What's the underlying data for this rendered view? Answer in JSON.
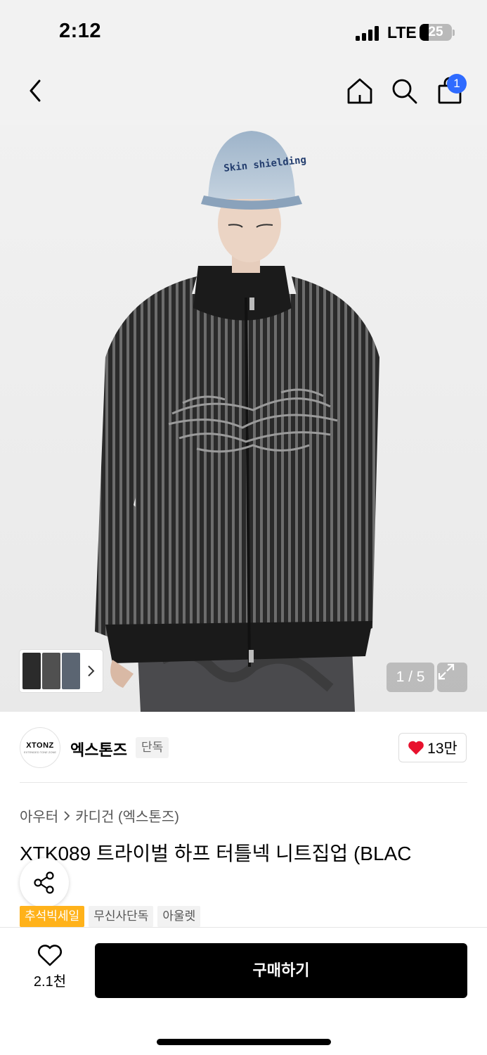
{
  "status_bar": {
    "time": "2:12",
    "network": "LTE",
    "battery": "25"
  },
  "nav": {
    "back_icon": "chevron-left-icon",
    "home_icon": "home-icon",
    "search_icon": "search-icon",
    "cart_icon": "shopping-bag-icon",
    "cart_count": "1",
    "badge_color": "#2f6bff"
  },
  "gallery": {
    "page": "1 / 5",
    "expand_icon": "expand-icon",
    "thumb_next_icon": "chevron-right-icon"
  },
  "brand": {
    "logo_text": "XTONZ",
    "logo_subtext": "EXTENDED TONE ZONE",
    "name": "엑스톤즈",
    "tag": "단독",
    "likes": "13만",
    "heart_color": "#e8112d"
  },
  "breadcrumb": {
    "level1": "아우터",
    "level2": "카디건 (엑스톤즈)"
  },
  "product": {
    "title": "XTK089 트라이벌 하프 터틀넥 니트집업 (BLAC",
    "tags": [
      "추석빅세일",
      "무신사단독",
      "아울렛"
    ],
    "sale_tag_color": "#ffb21a"
  },
  "bottom_bar": {
    "wish_count": "2.1천",
    "buy_label": "구매하기"
  }
}
